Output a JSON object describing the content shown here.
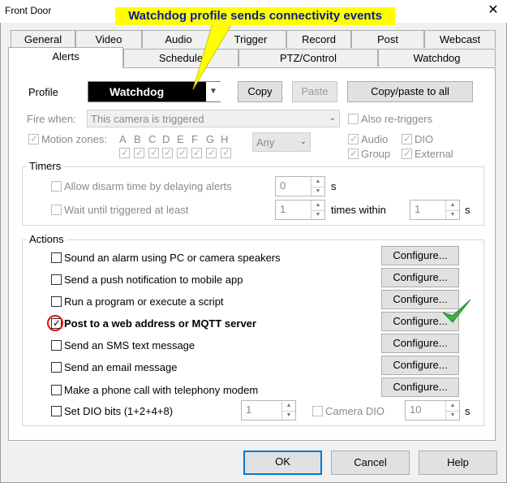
{
  "window": {
    "title": "Front Door",
    "close_glyph": "✕"
  },
  "callout": {
    "text": "Watchdog profile sends connectivity events"
  },
  "tabs_row1": [
    "General",
    "Video",
    "Audio",
    "Trigger",
    "Record",
    "Post",
    "Webcast"
  ],
  "tabs_row2": [
    "Alerts",
    "Schedule",
    "PTZ/Control",
    "Watchdog"
  ],
  "profile": {
    "label": "Profile",
    "value": "Watchdog",
    "copy": "Copy",
    "paste": "Paste",
    "copy_paste_all": "Copy/paste to all"
  },
  "fire_when": {
    "label": "Fire when:",
    "value": "This camera is triggered",
    "also_retriggers": "Also re-triggers"
  },
  "motion": {
    "label": "Motion zones:",
    "zones": [
      "A",
      "B",
      "C",
      "D",
      "E",
      "F",
      "G",
      "H"
    ],
    "any": "Any",
    "audio": "Audio",
    "dio": "DIO",
    "group": "Group",
    "external": "External"
  },
  "timers": {
    "title": "Timers",
    "disarm": "Allow disarm time by delaying alerts",
    "disarm_value": "0",
    "disarm_unit": "s",
    "wait": "Wait until triggered at least",
    "wait_value": "1",
    "times_within": "times within",
    "within_value": "1",
    "within_unit": "s"
  },
  "actions": {
    "title": "Actions",
    "configure": "Configure...",
    "items": [
      "Sound an alarm using PC or camera speakers",
      "Send a push notification to mobile app",
      "Run a program or execute a script",
      "Post to a web address or MQTT server",
      "Send an SMS text message",
      "Send an email message",
      "Make a phone call with telephony modem"
    ],
    "dio_bits": "Set DIO bits (1+2+4+8)",
    "dio_value": "1",
    "camera_dio": "Camera DIO",
    "dio_seconds": "10",
    "dio_unit": "s"
  },
  "footer": {
    "ok": "OK",
    "cancel": "Cancel",
    "help": "Help"
  },
  "colors": {
    "accent": "#0078d7",
    "callout_bg": "#ffff00",
    "callout_text": "#0a1a8c",
    "highlight": "#e01010",
    "check_green": "#3cb043"
  }
}
